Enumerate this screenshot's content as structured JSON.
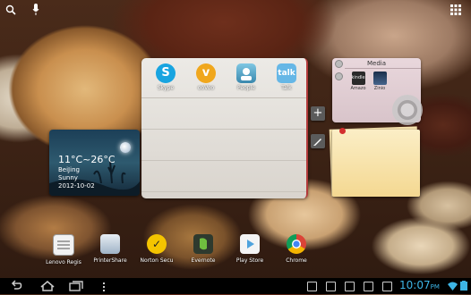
{
  "widgets": {
    "apps": [
      {
        "label": "Skype",
        "icon": "skype-icon",
        "color": "#18a4e0"
      },
      {
        "label": "ooVoo",
        "icon": "oovoo-icon",
        "color": "#f0a71d"
      },
      {
        "label": "People",
        "icon": "people-icon",
        "color": "#4ca3c9"
      },
      {
        "label": "Talk",
        "icon": "talk-icon",
        "color": "#66b7e6"
      }
    ]
  },
  "weather": {
    "temp": "11°C~26°C",
    "city": "BeiJing",
    "condition": "Sunny",
    "date": "2012-10-02"
  },
  "media": {
    "title": "Media",
    "apps": [
      {
        "label": "Amazo",
        "icon": "kindle-icon"
      },
      {
        "label": "Zinio",
        "icon": "zinio-icon"
      }
    ]
  },
  "dock": [
    {
      "label": "Lenovo Regis",
      "icon": "lenovo-register-icon"
    },
    {
      "label": "PrinterShare",
      "icon": "printershare-icon"
    },
    {
      "label": "Norton Secu",
      "icon": "norton-icon"
    },
    {
      "label": "Evernote",
      "icon": "evernote-icon"
    },
    {
      "label": "Play Store",
      "icon": "play-store-icon"
    },
    {
      "label": "Chrome",
      "icon": "chrome-icon"
    }
  ],
  "status": {
    "time": "10:07",
    "ampm": "PM"
  }
}
